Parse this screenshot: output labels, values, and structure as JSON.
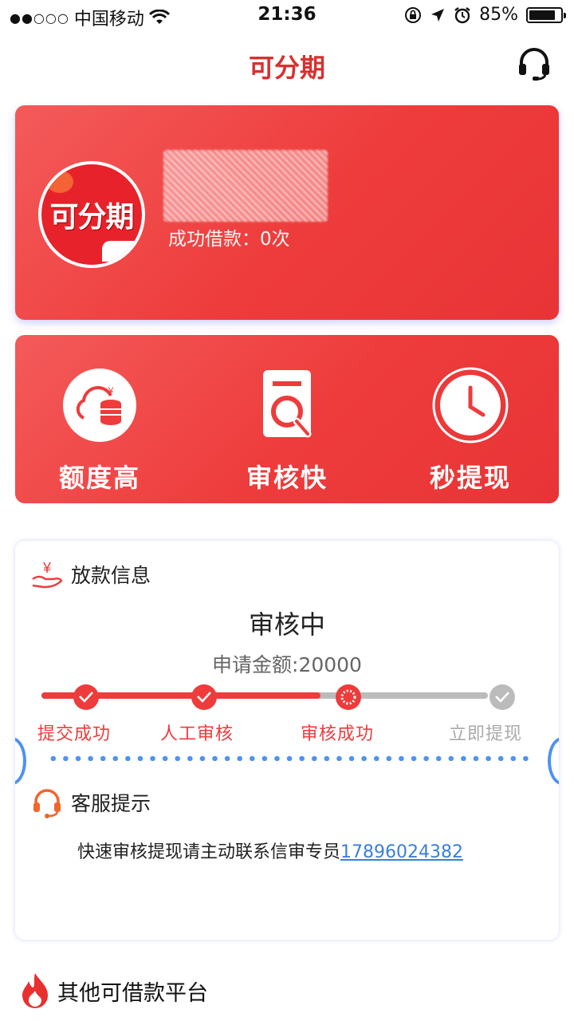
{
  "status_bar": {
    "signal": "●●○○○",
    "carrier": "中国移动",
    "time": "21:36",
    "battery": "85%",
    "battery_level": 0.85
  },
  "nav": {
    "title": "可分期",
    "support_icon": "headset-icon"
  },
  "profile": {
    "avatar_text": "可分期",
    "loan_count": "成功借款：0次"
  },
  "features": [
    {
      "label": "额度高",
      "icon": "cloud-coins-icon"
    },
    {
      "label": "审核快",
      "icon": "magnifier-document-icon"
    },
    {
      "label": "秒提现",
      "icon": "clock-icon"
    }
  ],
  "loan_info": {
    "heading": "放款信息",
    "heading_icon": "yen-hand-icon",
    "status": "审核中",
    "amount": "申请金额:20000",
    "progress_fraction": 0.625,
    "steps": [
      {
        "label": "提交成功",
        "state": "done"
      },
      {
        "label": "人工审核",
        "state": "done"
      },
      {
        "label": "审核成功",
        "state": "current"
      },
      {
        "label": "立即提现",
        "state": "pending"
      }
    ]
  },
  "support": {
    "heading": "客服提示",
    "heading_icon": "headset-icon",
    "text": "快速审核提现请主动联系信审专员",
    "phone": "17896024382"
  },
  "other": {
    "heading": "其他可借款平台",
    "icon": "flame-icon"
  },
  "colors": {
    "brand_red": "#ee3b3b",
    "title_red": "#d9302f",
    "link_blue": "#3a7fd8",
    "pending_gray": "#bbbbbb"
  }
}
